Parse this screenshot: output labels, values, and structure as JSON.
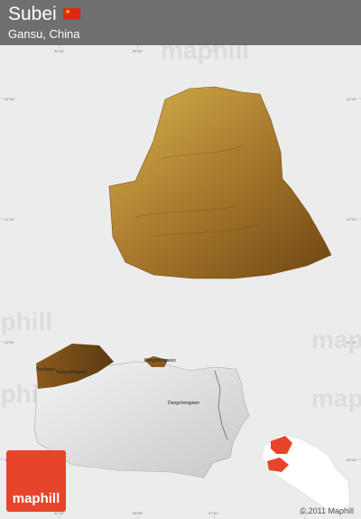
{
  "header": {
    "title": "Subei",
    "subtitle": "Gansu, China",
    "flag_icon": "china-flag-icon",
    "flag_star": "★",
    "flag_color": "#de2910"
  },
  "map": {
    "top_coords": [
      "94°40'",
      "95°50'",
      "97°00'"
    ],
    "bottom_coords": [
      "94°40'",
      "95°50'",
      "97°00'",
      "98°10'"
    ],
    "left_coords": [
      "42°40'",
      "41°20'",
      "40°00'",
      "38°40'"
    ],
    "right_coords": [
      "42°40'",
      "41°20'",
      "40°00'",
      "38°40'"
    ],
    "watermark": "maphill",
    "places": [
      "Dushanzi",
      "Dangchengwan",
      "Dangchengwan",
      "Dangchengwan"
    ],
    "terrain_color": "#a8782c",
    "shadow_color": "#d4d4d4"
  },
  "footer": {
    "logo_text": "maphill",
    "copyright": "© 2011 Maphill"
  }
}
